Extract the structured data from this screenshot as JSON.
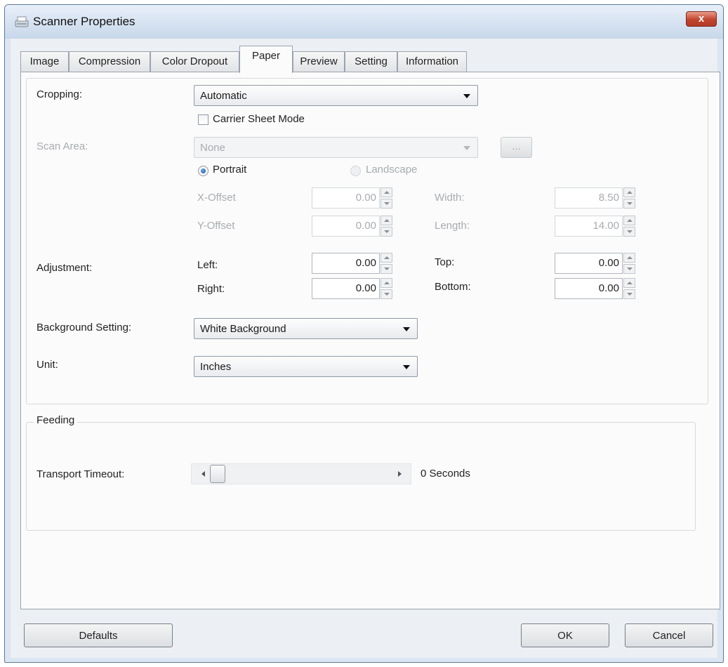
{
  "window": {
    "title": "Scanner Properties",
    "close_label": "x"
  },
  "tabs": [
    {
      "label": "Image"
    },
    {
      "label": "Compression"
    },
    {
      "label": "Color Dropout"
    },
    {
      "label": "Paper",
      "active": true
    },
    {
      "label": "Preview"
    },
    {
      "label": "Setting"
    },
    {
      "label": "Information"
    }
  ],
  "cropping": {
    "label": "Cropping:",
    "value": "Automatic",
    "carrier_sheet_label": "Carrier Sheet Mode",
    "carrier_sheet_checked": false
  },
  "scan_area": {
    "label": "Scan Area:",
    "value": "None",
    "browse_label": "...",
    "portrait_label": "Portrait",
    "landscape_label": "Landscape",
    "orientation_selected": "Portrait",
    "x_offset_label": "X-Offset",
    "x_offset_value": "0.00",
    "y_offset_label": "Y-Offset",
    "y_offset_value": "0.00",
    "width_label": "Width:",
    "width_value": "8.50",
    "length_label": "Length:",
    "length_value": "14.00"
  },
  "adjustment": {
    "label": "Adjustment:",
    "left_label": "Left:",
    "left_value": "0.00",
    "right_label": "Right:",
    "right_value": "0.00",
    "top_label": "Top:",
    "top_value": "0.00",
    "bottom_label": "Bottom:",
    "bottom_value": "0.00"
  },
  "background": {
    "label": "Background Setting:",
    "value": "White Background"
  },
  "unit": {
    "label": "Unit:",
    "value": "Inches"
  },
  "feeding": {
    "group_label": "Feeding",
    "timeout_label": "Transport Timeout:",
    "timeout_value_text": "0 Seconds",
    "timeout_fraction": 0.0
  },
  "footer": {
    "defaults_label": "Defaults",
    "ok_label": "OK",
    "cancel_label": "Cancel"
  },
  "colors": {
    "title_bar": "#c7d7ea",
    "close_button": "#c1452f",
    "panel": "#fbfbfb"
  }
}
